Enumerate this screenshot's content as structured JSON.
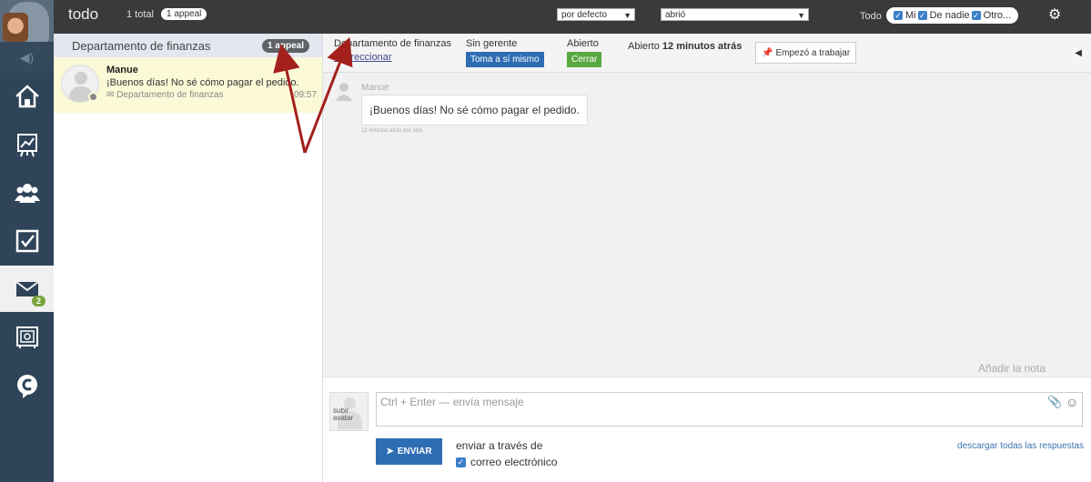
{
  "topbar": {
    "title": "todo",
    "total": "1 total",
    "appeal_pill": "1 appeal",
    "sort_select": "por defecto",
    "status_select": "abrió",
    "todo_label": "Todo",
    "filter_mi": "Mi",
    "filter_nadie": "De nadie",
    "filter_otro": "Otro..."
  },
  "sidebar": {
    "items": [
      {
        "icon": "home-icon"
      },
      {
        "icon": "chart-icon"
      },
      {
        "icon": "users-icon"
      },
      {
        "icon": "tasks-icon"
      },
      {
        "icon": "mail-icon",
        "badge": "2"
      },
      {
        "icon": "safe-icon"
      },
      {
        "icon": "chat-logo-icon"
      }
    ]
  },
  "list": {
    "header": "Departamento de finanzas",
    "badge": "1 appeal",
    "items": [
      {
        "name": "Manue",
        "message": "¡Buenos días! No sé cómo pagar el pedido.",
        "department": "Departamento de finanzas",
        "time": "09:57"
      }
    ]
  },
  "main": {
    "department": "Departamento de finanzas",
    "redirect": "redireccionar",
    "manager_label": "Sin gerente",
    "take_btn": "Toma a sí mismo",
    "state_label": "Abierto",
    "close_btn": "Cerrar",
    "opened_prefix": "Abierto",
    "opened_time": "12 minutos atrás",
    "started_btn": "Empezó a trabajar",
    "message_author": "Manue",
    "message_text": "¡Buenos días! No sé cómo pagar el pedido.",
    "message_meta": "12 minutos atrás por sitio",
    "add_note": "Añadir la nota"
  },
  "composer": {
    "upload_avatar": "subir avatar",
    "placeholder": "Ctrl + Enter — envía mensaje",
    "send": "ENVIAR",
    "send_via": "enviar a través de",
    "channel": "correo electrónico",
    "download": "descargar todas las respuestas"
  },
  "colors": {
    "sidebar": "#2f4458",
    "topbar": "#3a3a3a",
    "highlight_row": "#fcf9d7",
    "primary": "#2f6db3",
    "success": "#5aa842",
    "annotation_arrow": "#a4201c"
  }
}
